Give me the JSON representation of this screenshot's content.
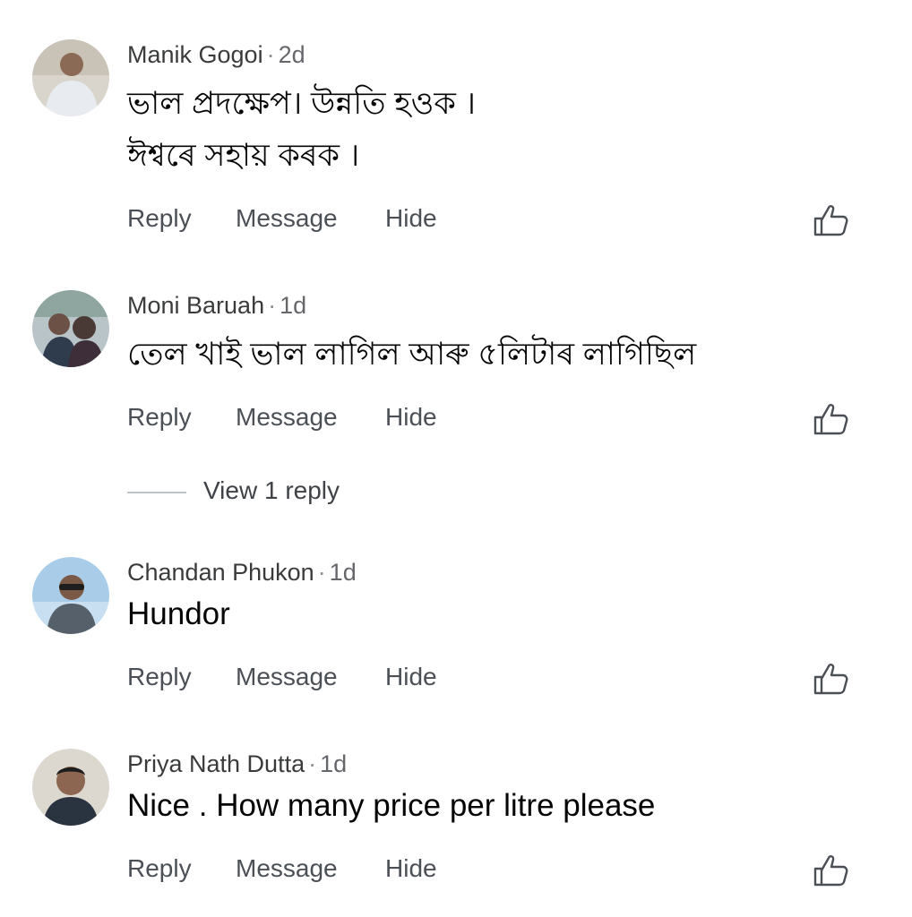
{
  "comments": [
    {
      "author": "Manik Gogoi",
      "separator": "·",
      "time": "2d",
      "lines": [
        "ভাল প্ৰদক্ষেপ।  উন্নতি হওক ।",
        "ঈশ্বৰে সহায় কৰক ।"
      ],
      "actions": {
        "reply": "Reply",
        "message": "Message",
        "hide": "Hide"
      }
    },
    {
      "author": "Moni Baruah",
      "separator": "·",
      "time": "1d",
      "lines": [
        "তেল খাই ভাল লাগিল আৰু ৫লিটাৰ লাগিছিল"
      ],
      "actions": {
        "reply": "Reply",
        "message": "Message",
        "hide": "Hide"
      },
      "view_replies": "View 1 reply"
    },
    {
      "author": "Chandan Phukon",
      "separator": "·",
      "time": "1d",
      "lines": [
        "Hundor"
      ],
      "actions": {
        "reply": "Reply",
        "message": "Message",
        "hide": "Hide"
      }
    },
    {
      "author": "Priya Nath Dutta",
      "separator": "·",
      "time": "1d",
      "lines": [
        "Nice . How many price per litre please"
      ],
      "actions": {
        "reply": "Reply",
        "message": "Message",
        "hide": "Hide"
      }
    }
  ],
  "icons": {
    "like": "thumbs-up-icon",
    "avatar": "avatar-photo"
  },
  "colors": {
    "text": "#050505",
    "meta": "#65676b",
    "action": "#4b4f56",
    "divider": "#bfc3ca"
  }
}
